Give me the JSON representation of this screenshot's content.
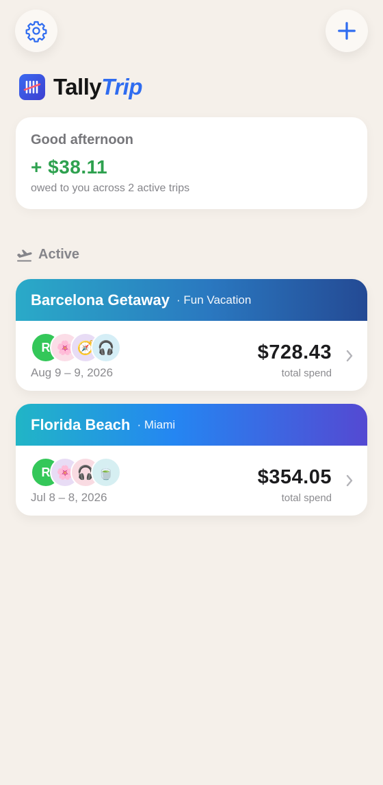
{
  "header": {
    "settings_icon": "gear-icon",
    "add_icon": "plus-icon",
    "accent_color": "#2f6cf0"
  },
  "logo": {
    "part1": "Tally",
    "part2": "Trip"
  },
  "summary": {
    "greeting": "Good afternoon",
    "amount": "+ $38.11",
    "subtitle": "owed to you across 2 active trips",
    "amount_color": "#2ea14f"
  },
  "section": {
    "label": "Active",
    "icon": "airplane-departure-icon"
  },
  "trips": [
    {
      "name": "Barcelona Getaway",
      "subtitle": "· Fun Vacation",
      "dates": "Aug 9 – 9, 2026",
      "amount": "$728.43",
      "amount_label": "total spend",
      "avatars": [
        {
          "type": "initial",
          "text": "R"
        },
        {
          "type": "emoji",
          "text": "🌸"
        },
        {
          "type": "emoji",
          "text": "🧭"
        },
        {
          "type": "emoji",
          "text": "🎧"
        }
      ]
    },
    {
      "name": "Florida Beach",
      "subtitle": "· Miami",
      "dates": "Jul 8 – 8, 2026",
      "amount": "$354.05",
      "amount_label": "total spend",
      "avatars": [
        {
          "type": "initial",
          "text": "R"
        },
        {
          "type": "emoji",
          "text": "🌸"
        },
        {
          "type": "emoji",
          "text": "🎧"
        },
        {
          "type": "emoji",
          "text": "🍵"
        }
      ]
    }
  ]
}
